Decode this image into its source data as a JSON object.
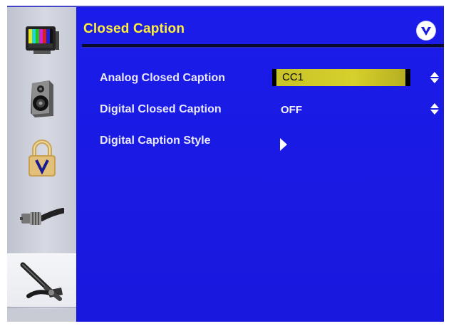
{
  "menu": {
    "title": "Closed Caption",
    "logo": "vizio-v-logo",
    "rows": [
      {
        "label": "Analog Closed Caption",
        "value": "CC1",
        "control": "up-down-icon",
        "selected": true
      },
      {
        "label": "Digital Closed Caption",
        "value": "OFF",
        "control": "up-down-icon",
        "selected": false
      },
      {
        "label": "Digital Caption Style",
        "value": "",
        "control": "arrow-right-icon",
        "selected": false
      }
    ]
  },
  "sidebar": {
    "items": [
      {
        "icon": "picture-tv-icon",
        "active": false
      },
      {
        "icon": "audio-speaker-icon",
        "active": false
      },
      {
        "icon": "parental-lock-icon",
        "active": false
      },
      {
        "icon": "tv-cable-icon",
        "active": false
      },
      {
        "icon": "setup-tools-icon",
        "active": true
      }
    ]
  },
  "colors": {
    "background": "#1a1ae0",
    "title": "#ffef3a",
    "highlight": "#d6d02c",
    "sidebar": "#d6d9e2"
  }
}
